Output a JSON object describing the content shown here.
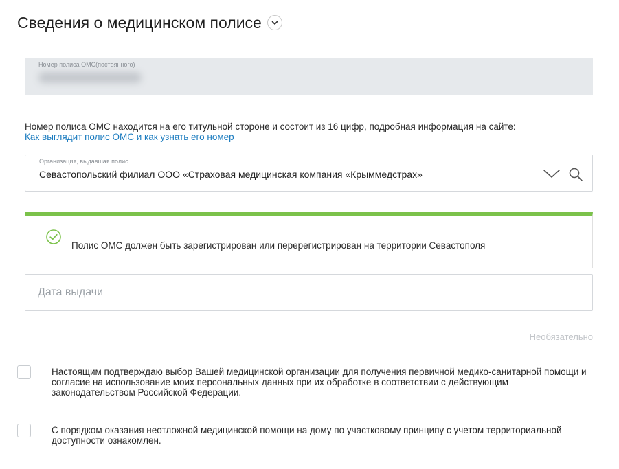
{
  "section": {
    "title": "Сведения о медицинском полисе"
  },
  "policy_number": {
    "label": "Номер полиса ОМС(постоянного)"
  },
  "info": {
    "text": "Номер полиса ОМС находится на его титульной стороне и состоит из 16 цифр, подробная информация на сайте:",
    "link": "Как выглядит полис ОМС и как узнать его номер"
  },
  "organization": {
    "label": "Организация, выдавшая полис",
    "value": "Севастопольский филиал ООО «Страховая медицинская компания «Крыммедстрах»"
  },
  "notice": {
    "text": "Полис ОМС должен быть зарегистрирован или перерегистрирован на территории Севастополя",
    "accent": "#7bc24a"
  },
  "issue_date": {
    "placeholder": "Дата выдачи",
    "hint": "Необязательно"
  },
  "consents": [
    {
      "text": "Настоящим подтверждаю выбор Вашей медицинской организации для получения первичной медико-санитарной помощи и согласие на использование моих персональных данных при их обработке в соответствии с действующим законодательством Российской Федерации.",
      "checked": false
    },
    {
      "text": "С порядком оказания неотложной медицинской помощи на дому по участковому принципу с учетом территориальной доступности ознакомлен.",
      "checked": false
    }
  ],
  "colors": {
    "link": "#1a7bbf",
    "success": "#7bc24a",
    "field_bg": "#e6e9ec"
  }
}
